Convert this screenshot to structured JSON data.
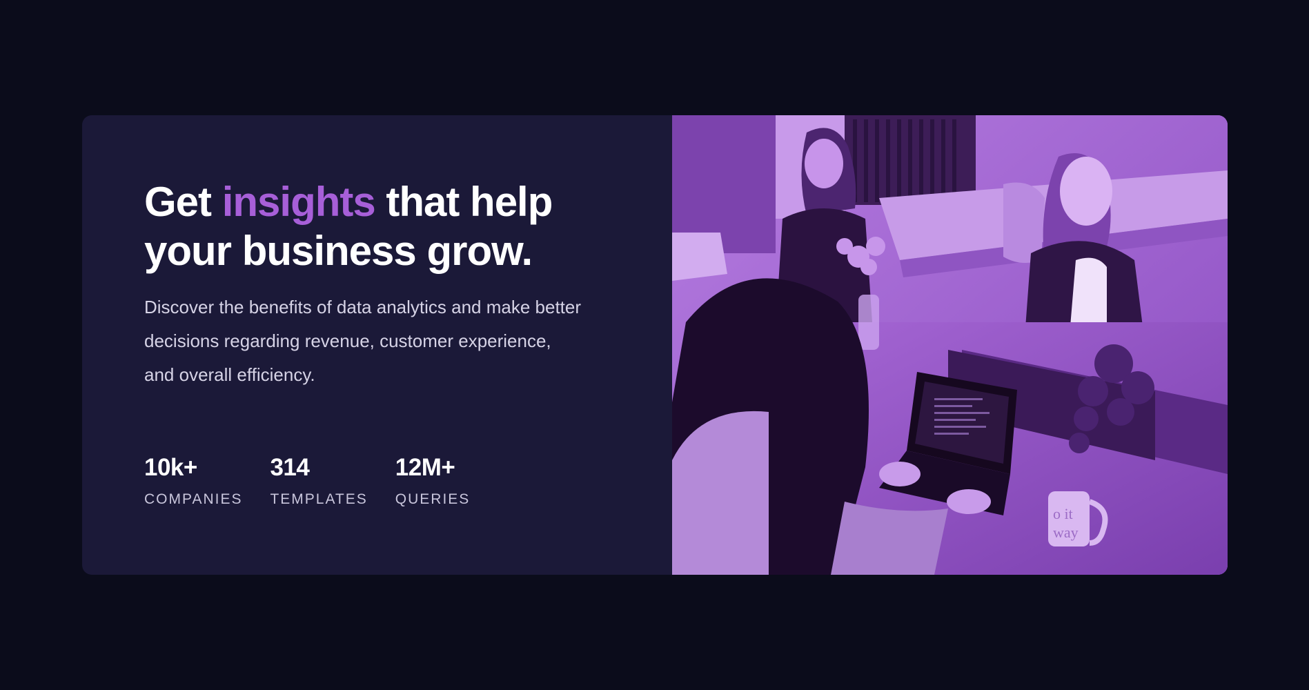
{
  "hero": {
    "headline_before": "Get ",
    "headline_accent": "insights",
    "headline_after": " that help your business grow.",
    "description": "Discover the benefits of data analytics and make better decisions regarding revenue, customer experience, and overall efficiency.",
    "stats": [
      {
        "value": "10k+",
        "label": "COMPANIES"
      },
      {
        "value": "314",
        "label": "TEMPLATES"
      },
      {
        "value": "12M+",
        "label": "QUERIES"
      }
    ]
  },
  "image": {
    "icon": "team-office-photo",
    "mug_text_line1": "o it",
    "mug_text_line2": "way"
  },
  "colors": {
    "page_background": "#0b0c1b",
    "card_background": "#1b1938",
    "accent": "#a75fd8",
    "image_tint": "#9a5ccc"
  }
}
